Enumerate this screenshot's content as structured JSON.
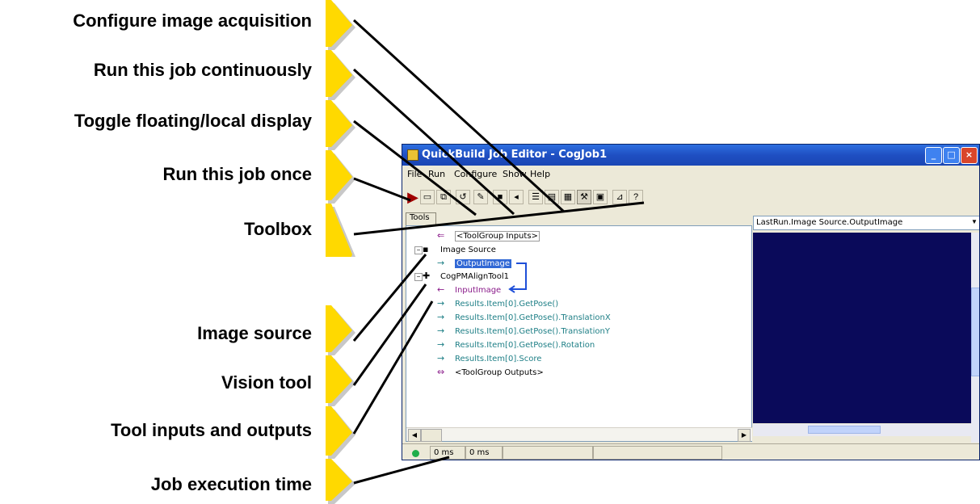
{
  "callouts": {
    "configure": "Configure image acquisition",
    "run_continuously": "Run this job continuously",
    "toggle_display": "Toggle floating/local display",
    "run_once": "Run this job once",
    "toolbox": "Toolbox",
    "image_source": "Image source",
    "vision_tool": "Vision tool",
    "tool_io": "Tool inputs and outputs",
    "exec_time": "Job execution time"
  },
  "colors": {
    "marker_fill": "#ffd900",
    "marker_shadow": "#c8c8c8",
    "title_bar": "#2461d6",
    "display_bg": "#0a0a5a",
    "link_line": "#1e4fd8",
    "selection": "#3168d5"
  },
  "window": {
    "title": "QuickBuild Job Editor - CogJob1",
    "menu": [
      "File",
      "Run",
      "Configure",
      "Show",
      "Help"
    ],
    "title_buttons": [
      "minimize-icon",
      "maximize-icon",
      "close-icon"
    ]
  },
  "tree": {
    "tab_label": "Tools",
    "rows": [
      {
        "text": "<ToolGroup Inputs>",
        "kind": "group-io"
      },
      {
        "text": "Image Source",
        "kind": "tool"
      },
      {
        "text": "OutputImage",
        "kind": "output-selected"
      },
      {
        "text": "CogPMAlignTool1",
        "kind": "tool"
      },
      {
        "text": "InputImage",
        "kind": "input"
      },
      {
        "text": "Results.Item[0].GetPose()",
        "kind": "output"
      },
      {
        "text": "Results.Item[0].GetPose().TranslationX",
        "kind": "output"
      },
      {
        "text": "Results.Item[0].GetPose().TranslationY",
        "kind": "output"
      },
      {
        "text": "Results.Item[0].GetPose().Rotation",
        "kind": "output"
      },
      {
        "text": "Results.Item[0].Score",
        "kind": "output"
      },
      {
        "text": "<ToolGroup Outputs>",
        "kind": "group-io"
      }
    ]
  },
  "display": {
    "selected": "LastRun.Image Source.OutputImage"
  },
  "status": {
    "time1": "0 ms",
    "time2": "0 ms"
  }
}
